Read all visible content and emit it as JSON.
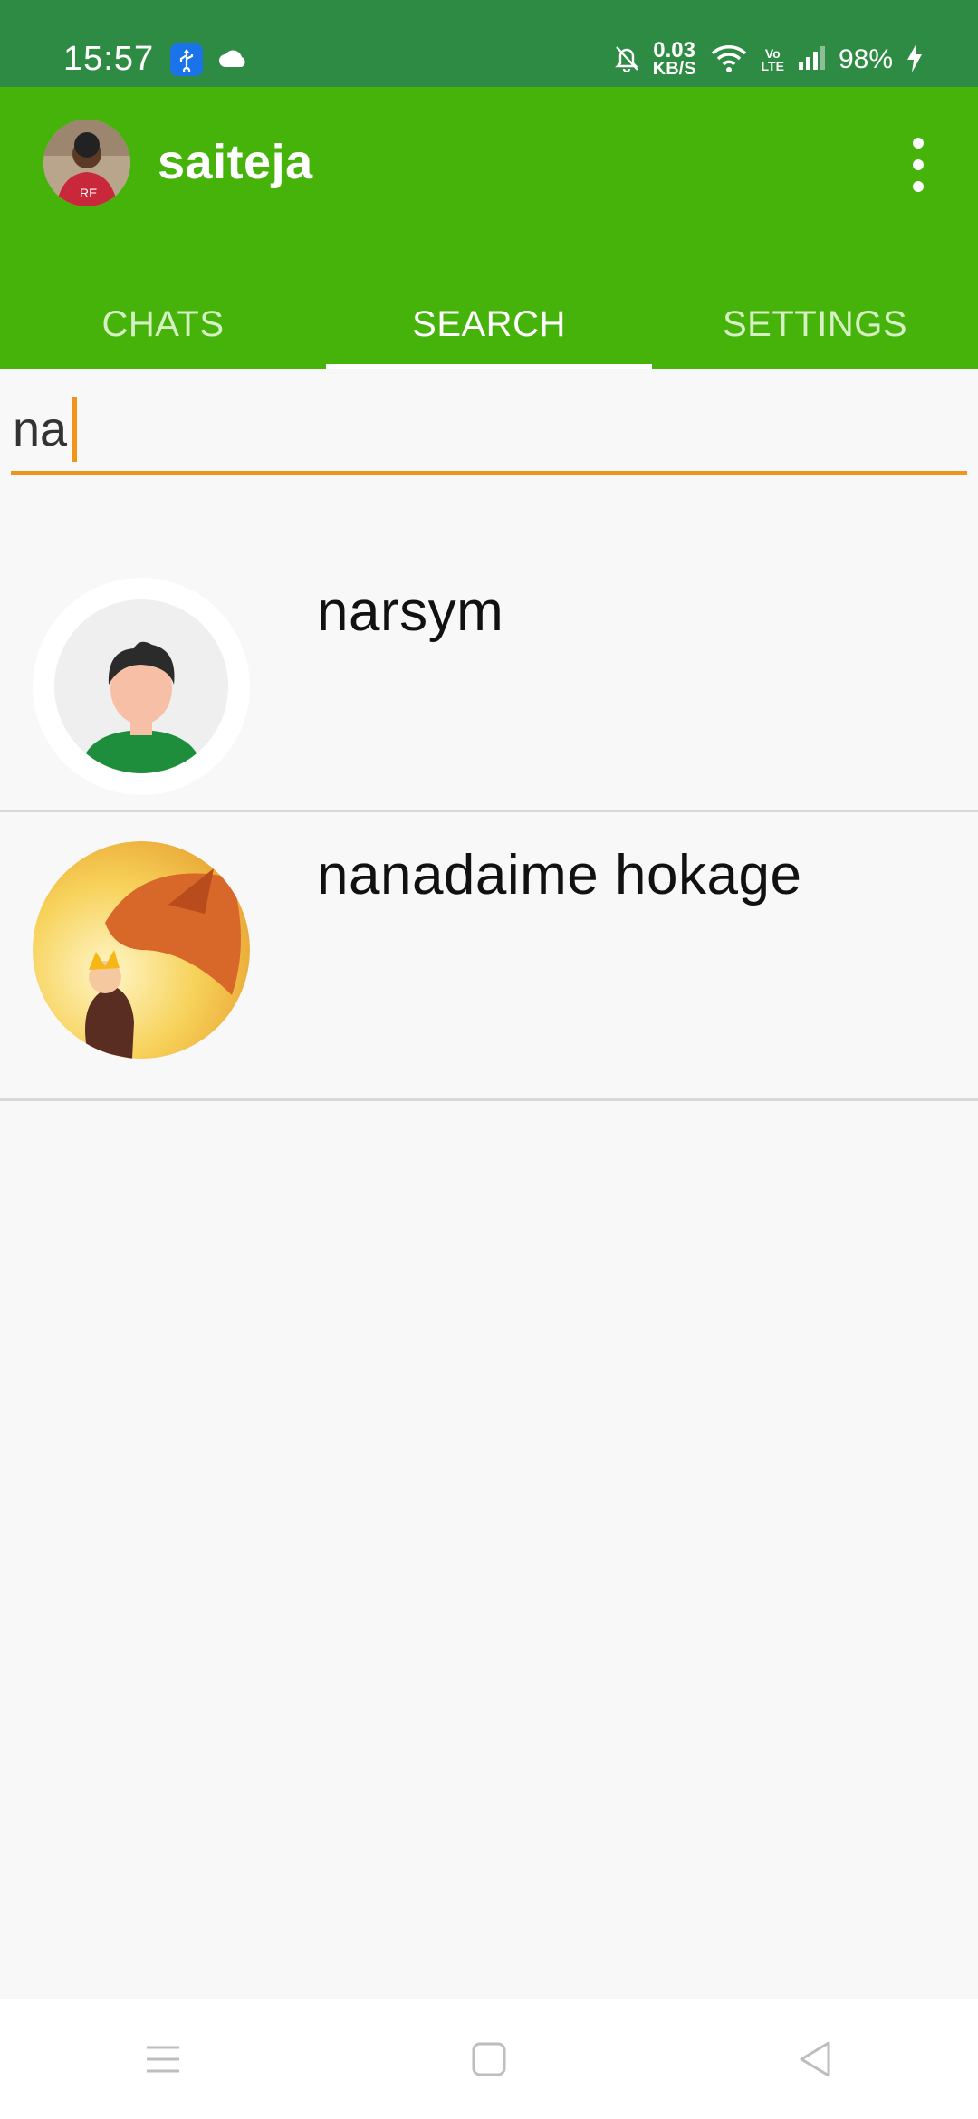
{
  "status": {
    "time": "15:57",
    "speed_value": "0.03",
    "speed_unit": "KB/S",
    "volte_top": "Vo",
    "volte_bottom": "LTE",
    "battery": "98%"
  },
  "app_bar": {
    "title": "saiteja",
    "tabs": [
      {
        "label": "CHATS",
        "active": false
      },
      {
        "label": "SEARCH",
        "active": true
      },
      {
        "label": "SETTINGS",
        "active": false
      }
    ]
  },
  "search": {
    "value": "na"
  },
  "results": [
    {
      "name": "narsym",
      "avatar": "default-avatar"
    },
    {
      "name": "nanadaime hokage",
      "avatar": "anime-avatar"
    }
  ],
  "colors": {
    "status_bar": "#2e8b44",
    "app_bar": "#46b30b",
    "accent": "#f0941c",
    "background": "#f8f8f8"
  },
  "nav": {
    "icons": [
      "menu-icon",
      "home-icon",
      "back-icon"
    ]
  }
}
